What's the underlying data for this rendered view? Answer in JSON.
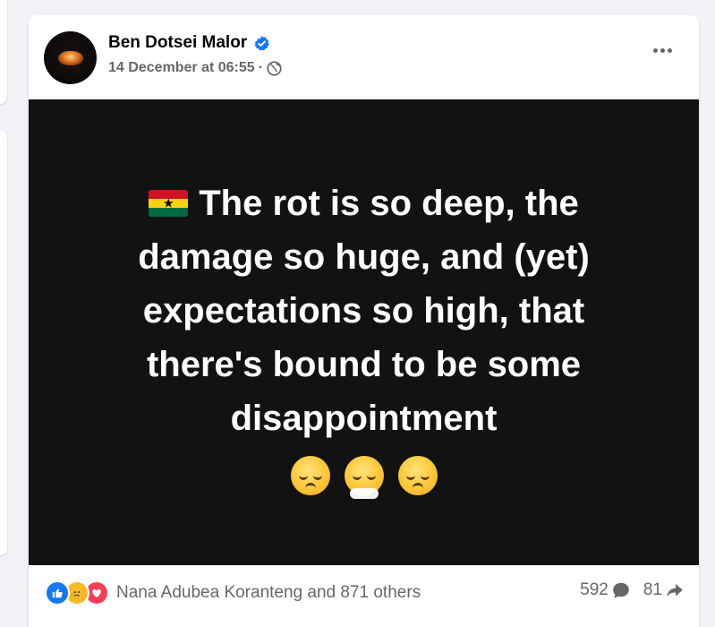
{
  "post": {
    "author": "Ben Dotsei Malor",
    "verified": true,
    "timestamp": "14 December at 06:55",
    "separator": "·",
    "privacy_icon": "globe-icon",
    "more_icon": "ellipsis-icon"
  },
  "content": {
    "flag_icon": "ghana-flag-emoji",
    "text": "The rot is so deep, the damage so huge, and (yet) expectations so high, that there's bound to be some disappointment",
    "emojis": [
      "disappointed-face-emoji",
      "face-exhaling-emoji",
      "disappointed-face-emoji"
    ],
    "background_color": "#121212",
    "text_color": "#ffffff"
  },
  "footer": {
    "reaction_icons": [
      "like-reaction-icon",
      "sad-reaction-icon",
      "love-reaction-icon"
    ],
    "reactions_text": "Nana Adubea Koranteng and 871 others",
    "comments_count": "592",
    "comment_icon": "comment-icon",
    "shares_count": "81",
    "share_icon": "share-icon"
  },
  "colors": {
    "accent": "#1877f2",
    "meta_text": "#65676b",
    "love": "#f33e58",
    "sad": "#f7b928"
  }
}
